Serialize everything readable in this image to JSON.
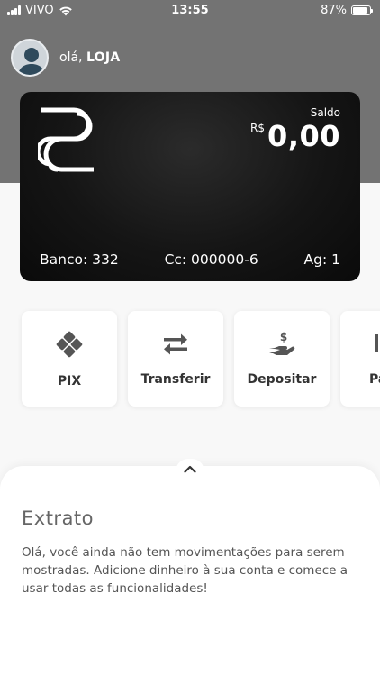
{
  "status_bar": {
    "carrier": "VIVO",
    "time": "13:55",
    "battery": "87%",
    "battery_level": 0.87
  },
  "header": {
    "greeting_prefix": "olá,",
    "user_name": "LOJA"
  },
  "card": {
    "saldo_label": "Saldo",
    "currency": "R$",
    "balance": "0,00",
    "banco": "Banco: 332",
    "conta": "Cc: 000000-6",
    "agencia": "Ag: 1"
  },
  "actions": [
    {
      "label": "PIX",
      "icon": "pix-icon"
    },
    {
      "label": "Transferir",
      "icon": "transfer-arrows-icon"
    },
    {
      "label": "Depositar",
      "icon": "deposit-hand-icon"
    },
    {
      "label": "Pa",
      "icon": "payment-icon"
    }
  ],
  "extrato": {
    "title": "Extrato",
    "message": "Olá, você ainda não tem movimentações para serem mostradas. Adicione dinheiro à sua conta e comece a usar todas as funcionalidades!"
  },
  "colors": {
    "header_bg": "#737373",
    "card_bg": "#111111",
    "icon_gray": "#555555"
  }
}
